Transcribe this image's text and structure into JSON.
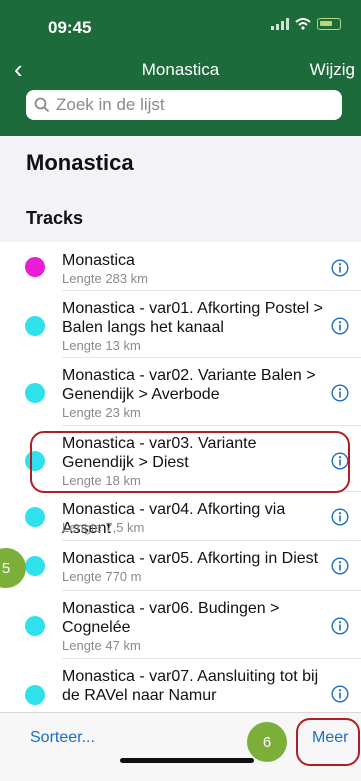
{
  "status": {
    "time": "09:45"
  },
  "nav": {
    "back": "‹",
    "title": "Monastica",
    "edit": "Wijzig"
  },
  "search": {
    "placeholder": "Zoek in de lijst"
  },
  "page_title": "Monastica",
  "section_title": "Tracks",
  "tracks": [
    {
      "title": "Monastica",
      "length": "Lengte 283 km",
      "color": "#e81ed6"
    },
    {
      "title": "Monastica - var01. Afkorting Postel > Balen langs het kanaal",
      "length": "Lengte 13 km",
      "color": "#2ee1ea"
    },
    {
      "title": "Monastica - var02. Variante Balen > Genendijk > Averbode",
      "length": "Lengte 23 km",
      "color": "#2ee1ea"
    },
    {
      "title": "Monastica - var03. Variante Genendijk > Diest",
      "length": "Lengte 18 km",
      "color": "#2ee1ea"
    },
    {
      "title": "Monastica - var04. Afkorting via Assent",
      "length": "Lengte 7,5 km",
      "color": "#2ee1ea"
    },
    {
      "title": "Monastica - var05. Afkorting in Diest",
      "length": "Lengte 770 m",
      "color": "#2ee1ea"
    },
    {
      "title": "Monastica - var06. Budingen > Cognelée",
      "length": "Lengte 47 km",
      "color": "#2ee1ea"
    },
    {
      "title": "Monastica - var07. Aansluiting tot bij de RAVel naar Namur",
      "length": "",
      "color": "#2ee1ea"
    }
  ],
  "toolbar": {
    "sort": "Sorteer...",
    "more": "Meer"
  },
  "annotations": {
    "badge_left": "5",
    "badge_right": "6"
  },
  "colors": {
    "header": "#1d6a3b",
    "accent": "#1a6ec2",
    "highlight": "#b01e24",
    "badge": "#7cae3a"
  }
}
